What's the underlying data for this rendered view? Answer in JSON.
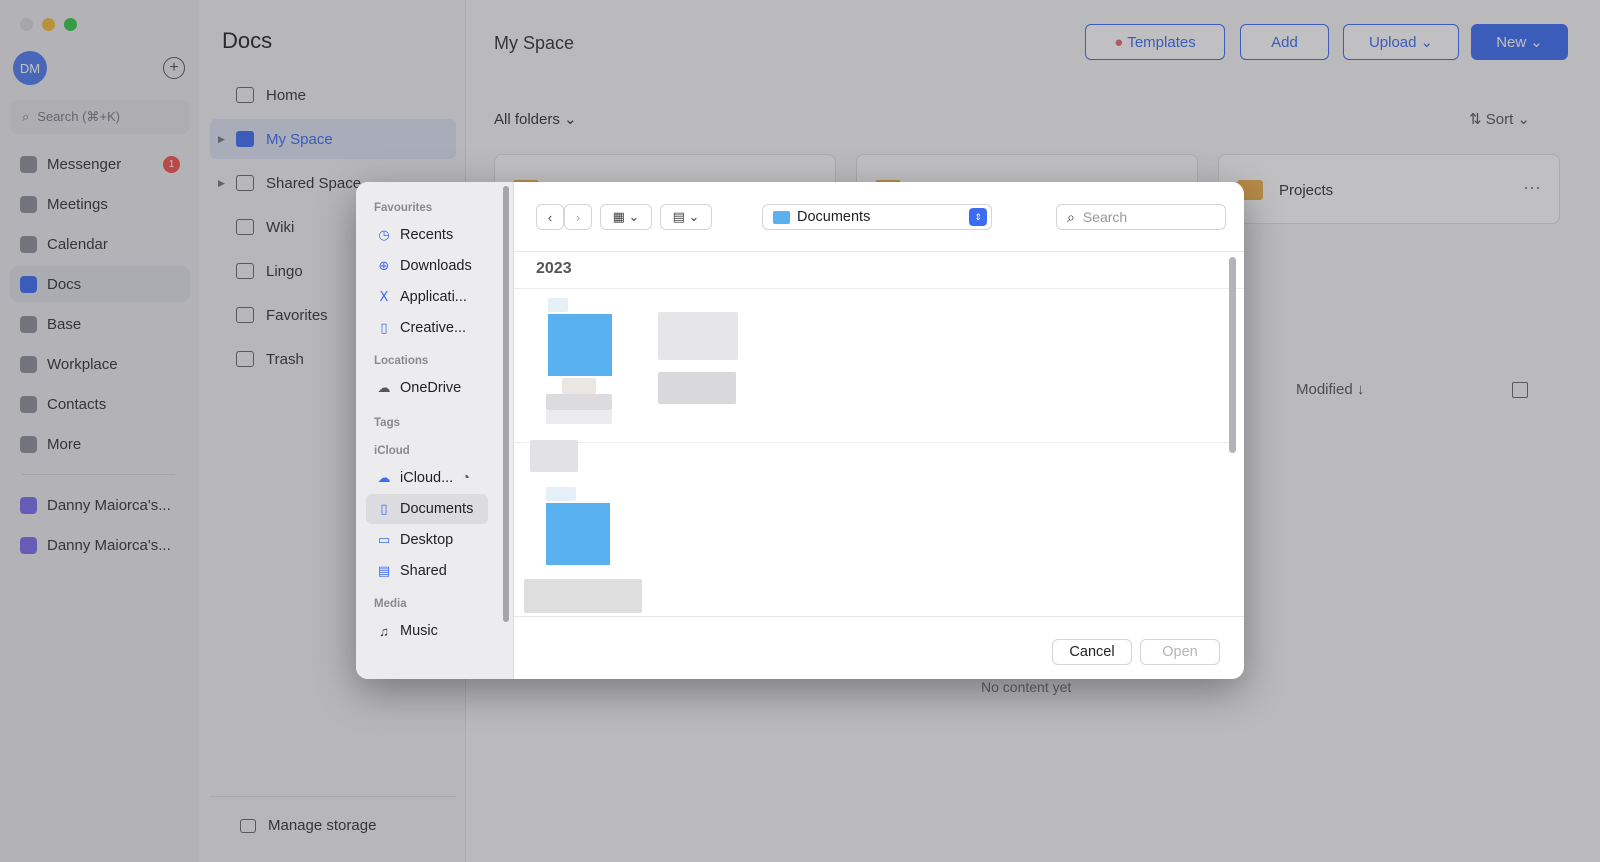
{
  "app": {
    "search_placeholder": "Search (⌘+K)",
    "avatar_initials": "DM",
    "nav": [
      {
        "label": "Messenger",
        "icon": "messenger-icon"
      },
      {
        "label": "Meetings",
        "icon": "meetings-icon"
      },
      {
        "label": "Calendar",
        "icon": "calendar-icon"
      },
      {
        "label": "Docs",
        "icon": "docs-icon",
        "active": true
      },
      {
        "label": "Base",
        "icon": "base-icon"
      },
      {
        "label": "Workplace",
        "icon": "workplace-icon"
      },
      {
        "label": "Contacts",
        "icon": "contacts-icon"
      },
      {
        "label": "More",
        "icon": "more-icon"
      }
    ],
    "messenger_badge": "1",
    "doc_links": [
      "Danny Maiorca's...",
      "Danny Maiorca's..."
    ]
  },
  "docs_pane": {
    "title": "Docs",
    "tree": [
      "Home",
      "My Space",
      "Shared Space",
      "Wiki",
      "Lingo",
      "Favorites",
      "Trash"
    ],
    "manage_storage": "Manage storage"
  },
  "main": {
    "title": "My Space",
    "buttons": {
      "templates": "Templates",
      "add": "Add",
      "upload": "Upload",
      "new": "New"
    },
    "all_folders": "All folders",
    "sort": "Sort",
    "folder_card_name": "Projects",
    "modified": "Modified ↓",
    "no_content": "No content yet"
  },
  "dialog": {
    "sidebar": {
      "favourites_title": "Favourites",
      "favourites": [
        "Recents",
        "Downloads",
        "Applicati...",
        "Creative..."
      ],
      "locations_title": "Locations",
      "locations": [
        "OneDrive"
      ],
      "tags_title": "Tags",
      "icloud_title": "iCloud",
      "icloud": [
        "iCloud...",
        "Documents",
        "Desktop",
        "Shared"
      ],
      "media_title": "Media",
      "media": [
        "Music"
      ]
    },
    "location": "Documents",
    "search_placeholder": "Search",
    "year_header": "2023",
    "cancel": "Cancel",
    "open": "Open"
  }
}
